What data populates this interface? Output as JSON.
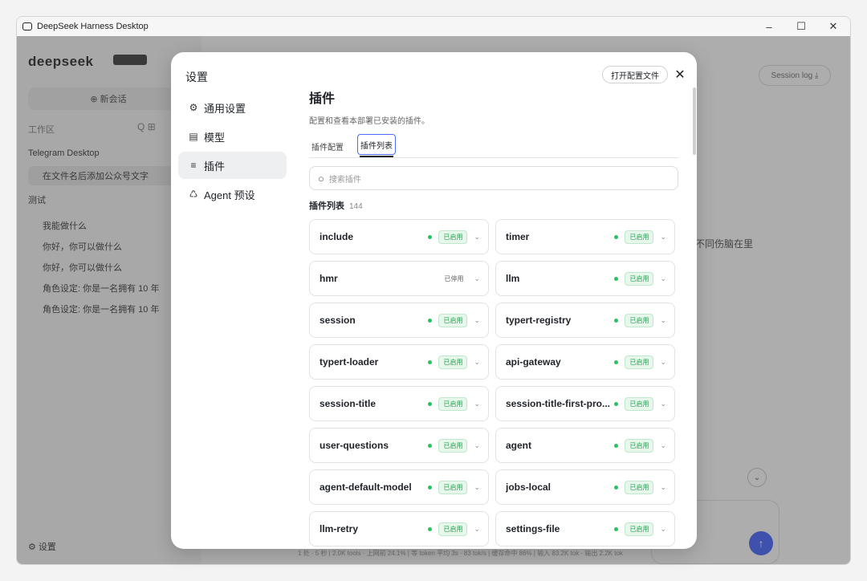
{
  "window": {
    "title": "DeepSeek Harness Desktop",
    "minimize": "–",
    "maximize": "☐",
    "close": "✕"
  },
  "background": {
    "logo": "deepseek",
    "new_chat": "⊕ 新会话",
    "workspace_label": "工作区",
    "workspace_tools": "Q ⊞",
    "items": [
      {
        "label": "Telegram Desktop"
      },
      {
        "label": "在文件名后添加公众号文字"
      },
      {
        "label": "测试"
      },
      {
        "label": "我能做什么"
      },
      {
        "label": "你好，你可以做什么"
      },
      {
        "label": "你好，你可以做什么"
      },
      {
        "label": "角色设定: 你是一名拥有 10 年"
      },
      {
        "label": "角色设定: 你是一名拥有 10 年"
      }
    ],
    "settings": "⚙ 设置",
    "session_log": "Session log ⤓",
    "top_strip": "...",
    "chat_text": "不同伤脑在里",
    "status_bar": "1 处 · 5 秒 | 2.0K tools · 上网前 24.1% | 等 token 平均 3s · 83 tok/s | 缓存命中 86% | 输入 83.2K tok · 输出 2.2K tok"
  },
  "dialog": {
    "title": "设置",
    "open_config": "打开配置文件",
    "close": "✕",
    "nav": [
      {
        "icon": "⚙",
        "label": "通用设置"
      },
      {
        "icon": "▤",
        "label": "模型"
      },
      {
        "icon": "≡",
        "label": "插件"
      },
      {
        "icon": "♺",
        "label": "Agent 预设"
      }
    ],
    "heading": "插件",
    "description": "配置和查看本部署已安装的插件。",
    "tabs": [
      "插件配置",
      "插件列表"
    ],
    "search_placeholder": "搜索插件",
    "list_title": "插件列表",
    "list_count": "144",
    "plugins": [
      {
        "name": "include",
        "status": "已启用",
        "enabled": true
      },
      {
        "name": "timer",
        "status": "已启用",
        "enabled": true
      },
      {
        "name": "hmr",
        "status": "已停用",
        "enabled": false
      },
      {
        "name": "llm",
        "status": "已启用",
        "enabled": true
      },
      {
        "name": "session",
        "status": "已启用",
        "enabled": true
      },
      {
        "name": "typert-registry",
        "status": "已启用",
        "enabled": true
      },
      {
        "name": "typert-loader",
        "status": "已启用",
        "enabled": true
      },
      {
        "name": "api-gateway",
        "status": "已启用",
        "enabled": true
      },
      {
        "name": "session-title",
        "status": "已启用",
        "enabled": true
      },
      {
        "name": "session-title-first-pro...",
        "status": "已启用",
        "enabled": true
      },
      {
        "name": "user-questions",
        "status": "已启用",
        "enabled": true
      },
      {
        "name": "agent",
        "status": "已启用",
        "enabled": true
      },
      {
        "name": "agent-default-model",
        "status": "已启用",
        "enabled": true
      },
      {
        "name": "jobs-local",
        "status": "已启用",
        "enabled": true
      },
      {
        "name": "llm-retry",
        "status": "已启用",
        "enabled": true
      },
      {
        "name": "settings-file",
        "status": "已启用",
        "enabled": true
      }
    ]
  },
  "colors": {
    "accent": "#4d6bfe",
    "enabled_green": "#22c55e"
  }
}
